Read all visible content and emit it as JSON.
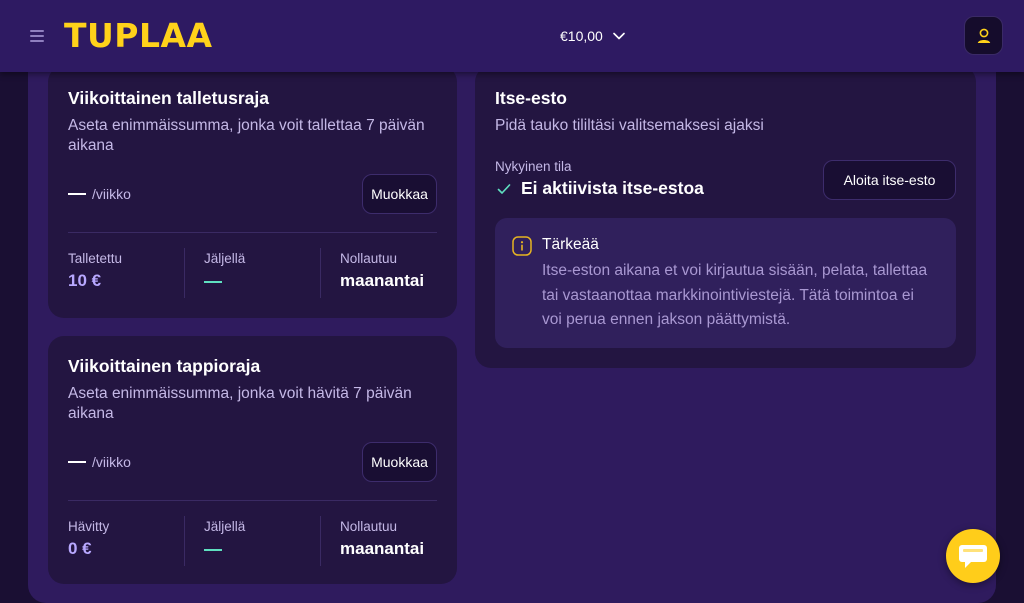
{
  "header": {
    "logo": "TUPLAA",
    "balance": "€10,00"
  },
  "deposit_limit": {
    "title": "Viikoittainen talletusraja",
    "description": "Aseta enimmäissumma, jonka voit tallettaa 7 päivän aikana",
    "period": "/viikko",
    "edit_label": "Muokkaa",
    "stats": {
      "used_label": "Talletettu",
      "used_value": "10 €",
      "remaining_label": "Jäljellä",
      "reset_label": "Nollautuu",
      "reset_value": "maanantai"
    }
  },
  "loss_limit": {
    "title": "Viikoittainen tappioraja",
    "description": "Aseta enimmäissumma, jonka voit hävitä 7 päivän aikana",
    "period": "/viikko",
    "edit_label": "Muokkaa",
    "stats": {
      "used_label": "Hävitty",
      "used_value": "0 €",
      "remaining_label": "Jäljellä",
      "reset_label": "Nollautuu",
      "reset_value": "maanantai"
    }
  },
  "self_exclusion": {
    "title": "Itse-esto",
    "description": "Pidä tauko tililtäsi valitsemaksesi ajaksi",
    "state_label": "Nykyinen tila",
    "state_value": "Ei aktiivista itse-estoa",
    "action_label": "Aloita itse-esto",
    "notice": {
      "title": "Tärkeää",
      "body": "Itse-eston aikana et voi kirjautua sisään, pelata, tallettaa tai vastaanottaa markkinointiviestejä. Tätä toimintoa ei voi perua ennen jakson päättymistä."
    }
  },
  "colors": {
    "brand": "#ffd21a",
    "accent": "#b8a8ff",
    "success": "#5fe0c0",
    "warning": "#e6b422"
  },
  "icons": [
    "menu-icon",
    "chevron-down-icon",
    "user-icon",
    "check-icon",
    "info-icon",
    "chat-icon"
  ]
}
